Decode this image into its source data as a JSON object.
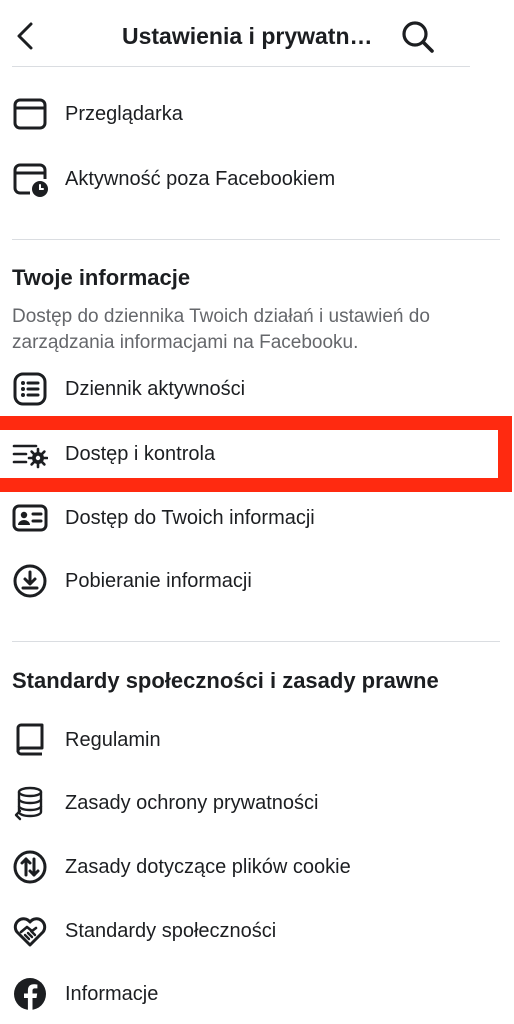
{
  "header": {
    "title": "Ustawienia i prywatno…",
    "back_icon": "chevron-left-icon",
    "search_icon": "search-icon"
  },
  "browser_section": {
    "items": [
      {
        "label": "Przeglądarka",
        "icon": "browser-window-icon"
      },
      {
        "label": "Aktywność poza Facebookiem",
        "icon": "browser-clock-icon"
      }
    ]
  },
  "your_info": {
    "title": "Twoje informacje",
    "description": "Dostęp do dziennika Twoich działań i ustawień do zarządzania informacjami na Facebooku.",
    "items": [
      {
        "label": "Dziennik aktywności",
        "icon": "activity-log-icon"
      },
      {
        "label": "Dostęp i kontrola",
        "icon": "list-settings-icon"
      },
      {
        "label": "Dostęp do Twoich informacji",
        "icon": "id-card-icon"
      },
      {
        "label": "Pobieranie informacji",
        "icon": "download-circle-icon"
      }
    ]
  },
  "legal": {
    "title": "Standardy społeczności i zasady prawne",
    "items": [
      {
        "label": "Regulamin",
        "icon": "book-icon"
      },
      {
        "label": "Zasady ochrony prywatności",
        "icon": "database-privacy-icon"
      },
      {
        "label": "Zasady dotyczące plików cookie",
        "icon": "cookie-arrows-icon"
      },
      {
        "label": "Standardy społeczności",
        "icon": "heart-handshake-icon"
      },
      {
        "label": "Informacje",
        "icon": "facebook-logo-icon"
      }
    ]
  },
  "colors": {
    "highlight": "#ff2a10",
    "text_primary": "#1c1e21",
    "text_secondary": "#65676b",
    "divider": "#dadde1"
  }
}
